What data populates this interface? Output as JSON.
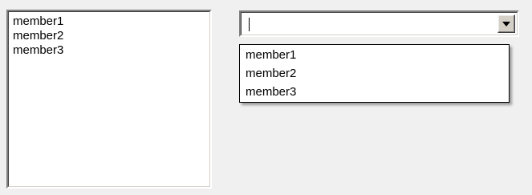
{
  "listbox": {
    "items": [
      {
        "label": "member1"
      },
      {
        "label": "member2"
      },
      {
        "label": "member3"
      }
    ]
  },
  "combobox": {
    "value": "",
    "dropdown_icon": "chevron-down-icon",
    "options": [
      {
        "label": "member1"
      },
      {
        "label": "member2"
      },
      {
        "label": "member3"
      }
    ]
  },
  "colors": {
    "background": "#f0f0f0",
    "field_background": "#ffffff",
    "border_dark": "#808080",
    "text": "#000000"
  }
}
